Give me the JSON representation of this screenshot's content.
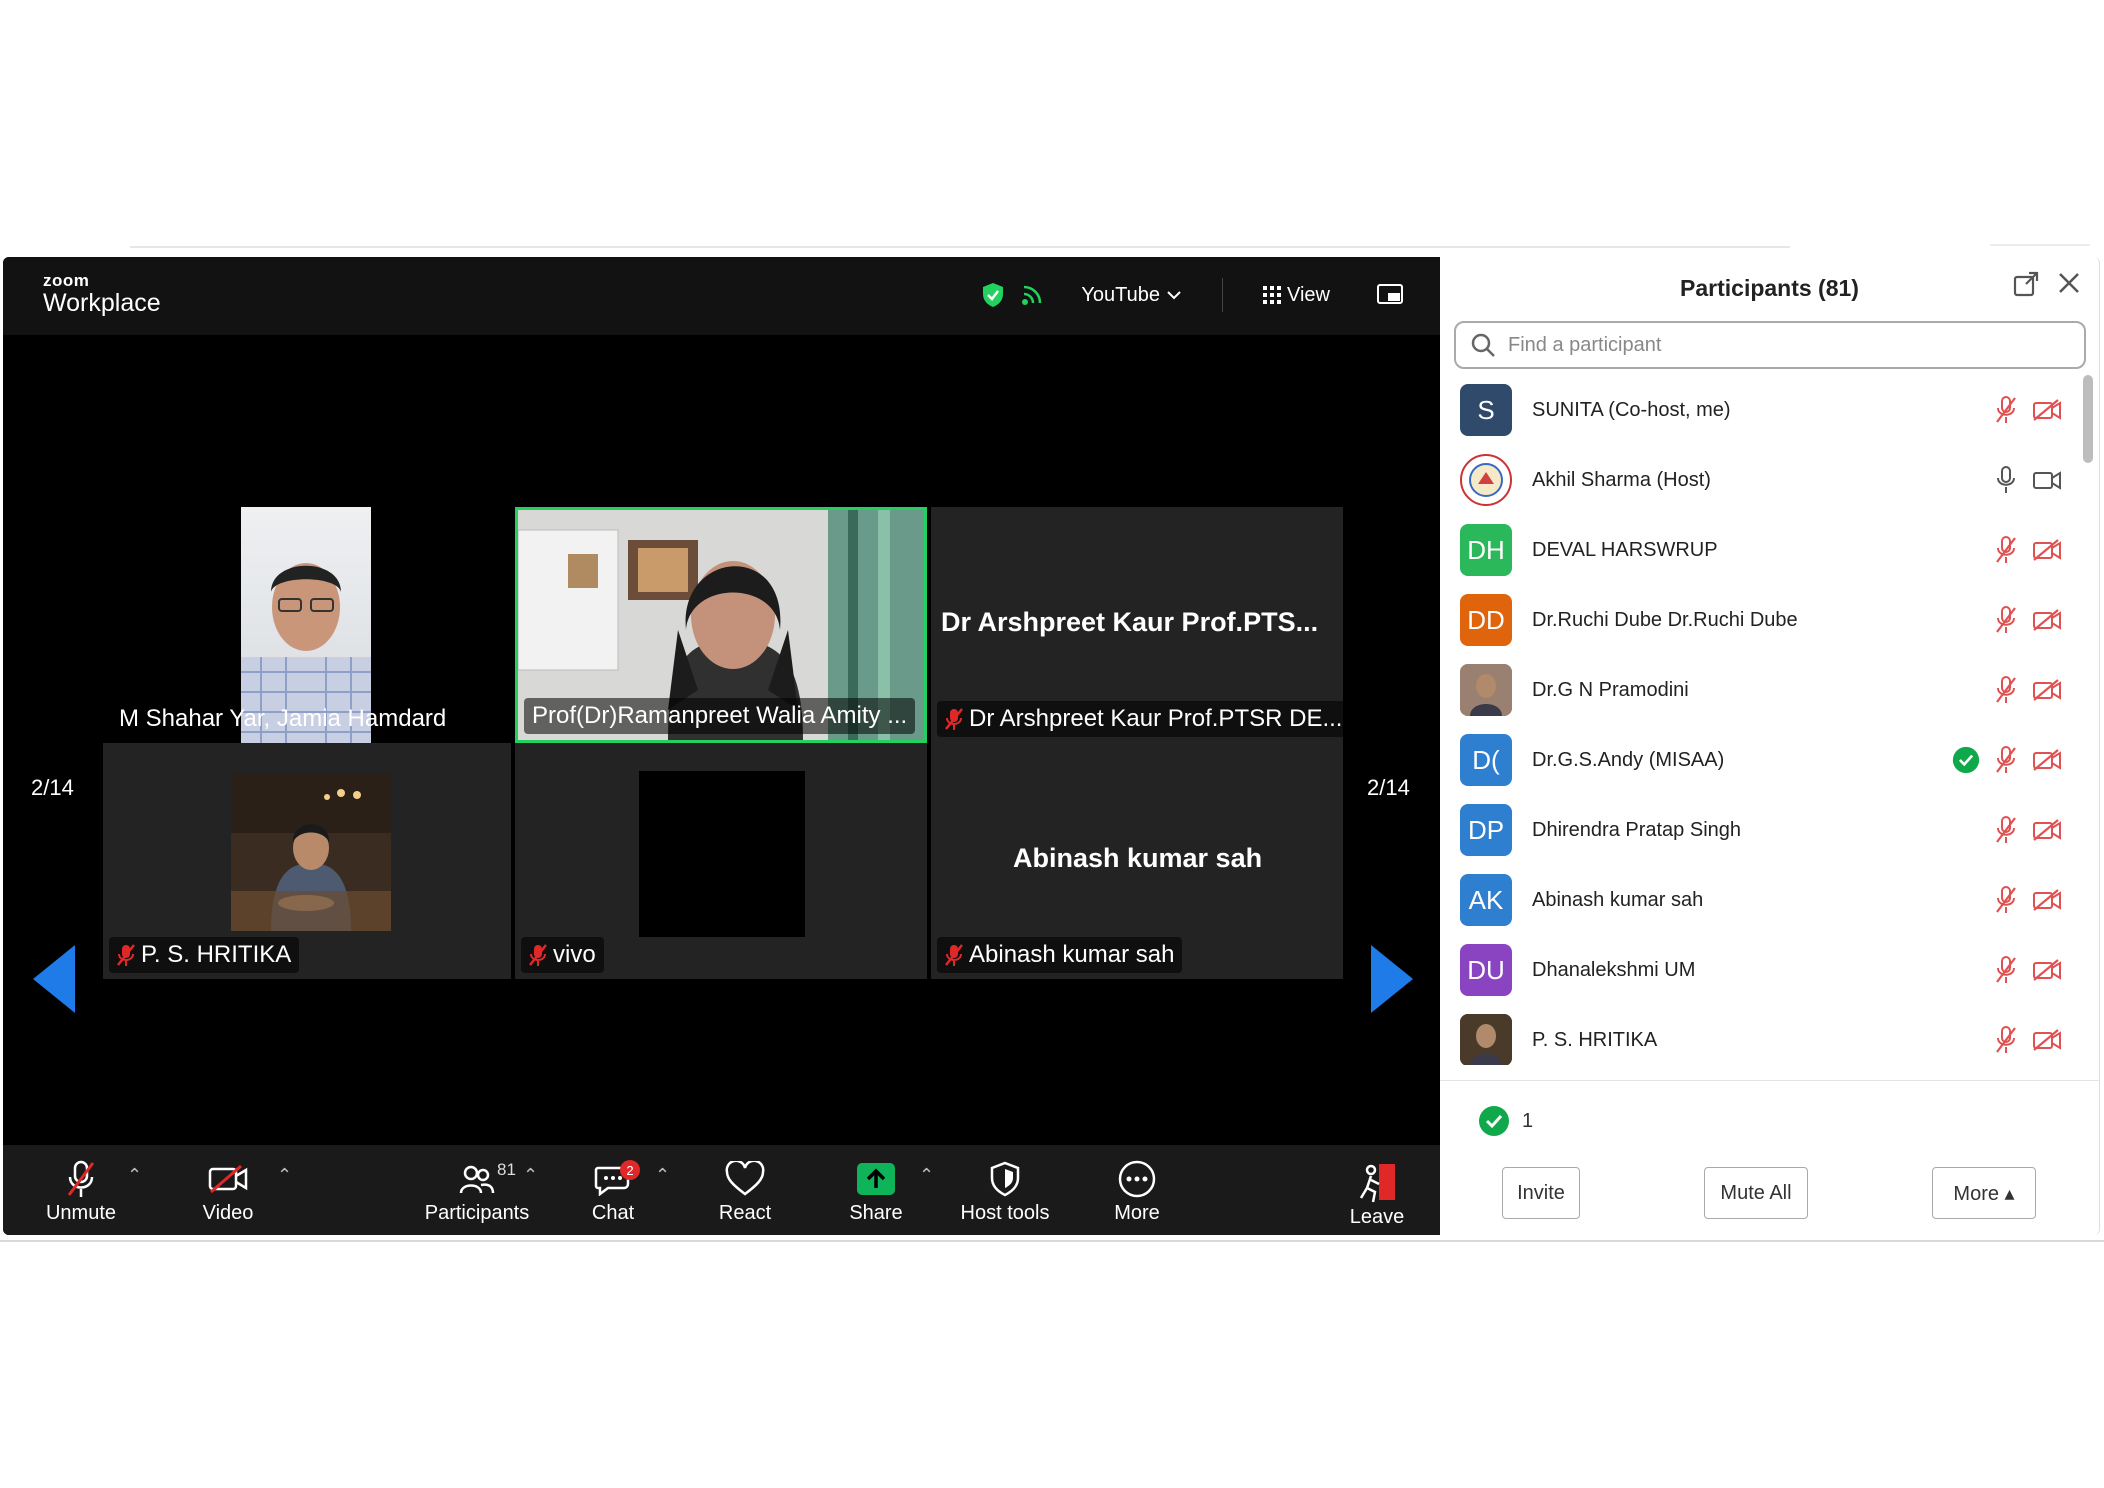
{
  "window": {
    "brand_small": "zoom",
    "brand_large": "Workplace",
    "live_label": "YouTube",
    "view_label": "View"
  },
  "gallery": {
    "page_left": "2/14",
    "page_right": "2/14",
    "tiles": [
      {
        "name": "M Shahar Yar, Jamia Hamdard"
      },
      {
        "name": "Prof(Dr)Ramanpreet Walia Amity ..."
      },
      {
        "big_name": "Dr Arshpreet Kaur Prof.PTS...",
        "name": "Dr Arshpreet Kaur Prof.PTSR DE..."
      },
      {
        "name": "P. S. HRITIKA"
      },
      {
        "name": "vivo"
      },
      {
        "big_name": "Abinash kumar sah",
        "name": "Abinash kumar sah"
      }
    ]
  },
  "toolbar": {
    "unmute": "Unmute",
    "video": "Video",
    "participants": "Participants",
    "participants_count": "81",
    "chat": "Chat",
    "chat_badge": "2",
    "react": "React",
    "share": "Share",
    "host_tools": "Host tools",
    "more": "More",
    "leave": "Leave"
  },
  "panel": {
    "title": "Participants (81)",
    "search_placeholder": "Find a participant",
    "participants": [
      {
        "initials": "S",
        "name": "SUNITA (Co-host, me)",
        "color": "#2f4a6b",
        "muted": true
      },
      {
        "initials": "",
        "name": "Akhil Sharma (Host)",
        "color": "#ffffff",
        "muted": false
      },
      {
        "initials": "DH",
        "name": "DEVAL HARSWRUP",
        "color": "#2bb85a",
        "muted": true
      },
      {
        "initials": "DD",
        "name": "Dr.Ruchi Dube Dr.Ruchi Dube",
        "color": "#e0640c",
        "muted": true
      },
      {
        "initials": "",
        "name": "Dr.G N Pramodini",
        "color": "#9a8070",
        "muted": true
      },
      {
        "initials": "D(",
        "name": "Dr.G.S.Andy (MISAA)",
        "color": "#2f7fd0",
        "muted": true,
        "check": true
      },
      {
        "initials": "DP",
        "name": "Dhirendra Pratap Singh",
        "color": "#2f7fd0",
        "muted": true
      },
      {
        "initials": "AK",
        "name": "Abinash kumar sah",
        "color": "#2f7fd0",
        "muted": true
      },
      {
        "initials": "DU",
        "name": "Dhanalekshmi UM",
        "color": "#8a44c2",
        "muted": true
      },
      {
        "initials": "",
        "name": "P. S. HRITIKA",
        "color": "#4a3a2a",
        "muted": true
      }
    ],
    "checked_count": "1",
    "invite": "Invite",
    "mute_all": "Mute All",
    "more": "More ▴"
  },
  "colors": {
    "active_speaker": "#23d160",
    "nav_arrow": "#1e7be8",
    "muted_red": "#e02828",
    "share_green": "#0fb35a"
  }
}
